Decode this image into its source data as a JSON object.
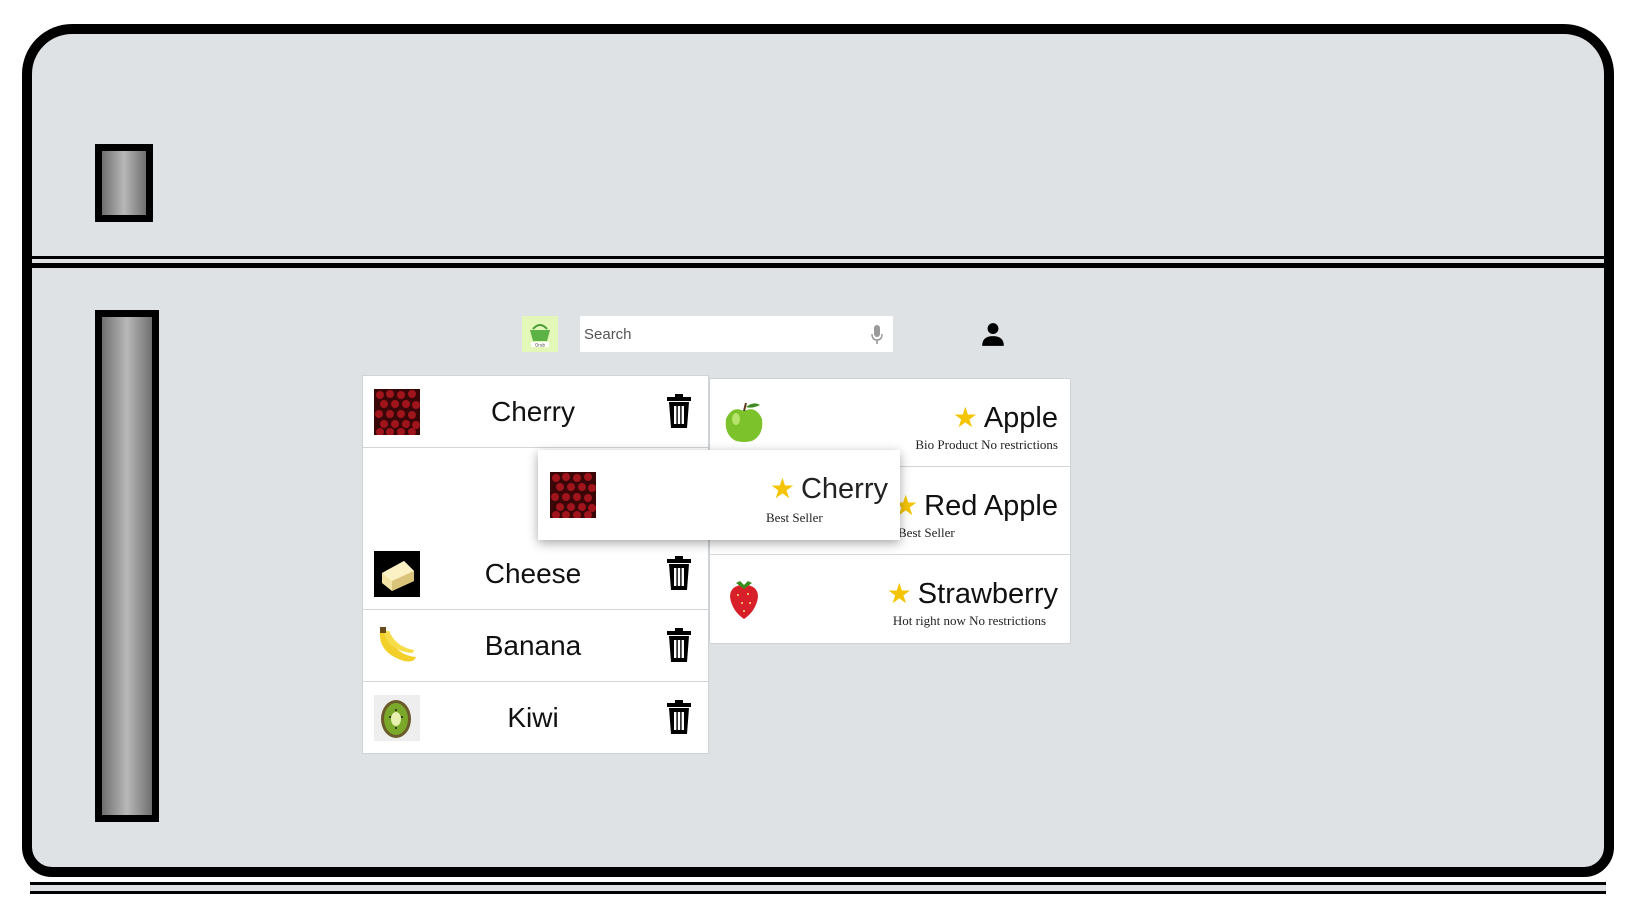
{
  "search": {
    "placeholder": "Search"
  },
  "shopping_list": {
    "items": [
      {
        "name": "Cherry",
        "image": "cherry-image"
      },
      {
        "name": "Cheese",
        "image": "cheese-image"
      },
      {
        "name": "Banana",
        "image": "banana-image"
      },
      {
        "name": "Kiwi",
        "image": "kiwi-image"
      }
    ]
  },
  "products": [
    {
      "name": "Apple",
      "subtitle": "Bio Product No restrictions",
      "badge": "star-icon",
      "image": "apple-image"
    },
    {
      "name": "Red Apple",
      "subtitle": "Best Seller",
      "badge": "star-icon",
      "image": "red-apple-image"
    },
    {
      "name": "Strawberry",
      "subtitle": "Hot right now No restrictions",
      "badge": "star-icon",
      "image": "strawberry-image"
    }
  ],
  "dragging": {
    "name": "Cherry",
    "subtitle": "Best Seller",
    "badge": "star-icon",
    "image": "cherry-image"
  },
  "icons": {
    "logo": "basket-logo",
    "mic": "microphone-icon",
    "user": "user-icon",
    "delete": "trash-icon",
    "star": "★"
  },
  "colors": {
    "star": "#f5c400",
    "fridge": "#dfe2e5",
    "logo_bg": "#e3f7b8"
  }
}
